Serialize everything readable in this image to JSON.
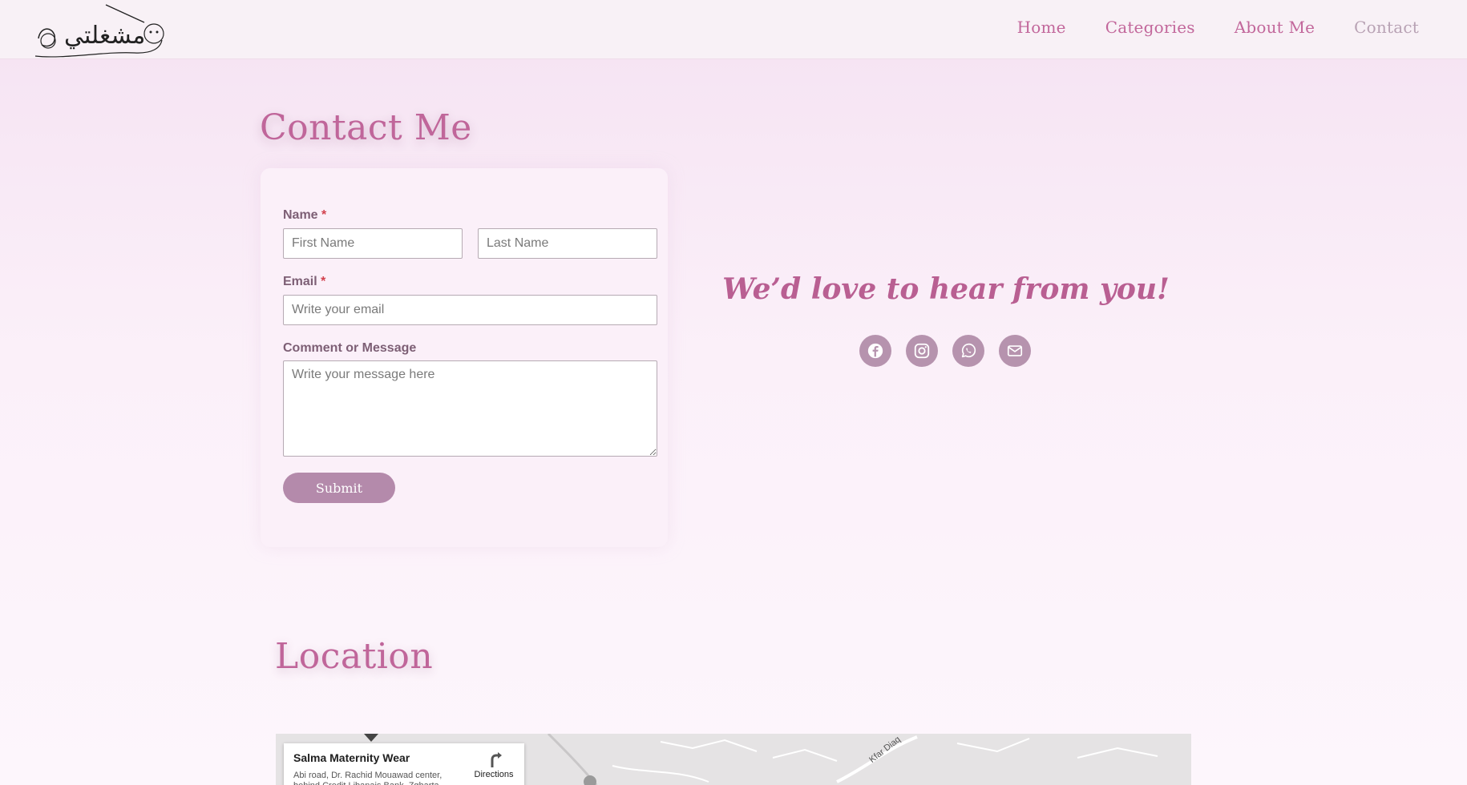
{
  "header": {
    "logo_text": "مشغلتي",
    "nav": [
      {
        "label": "Home",
        "current": false
      },
      {
        "label": "Categories",
        "current": false
      },
      {
        "label": "About Me",
        "current": false
      },
      {
        "label": "Contact",
        "current": true
      }
    ]
  },
  "contact": {
    "title": "Contact Me",
    "form": {
      "name_label": "Name",
      "email_label": "Email",
      "message_label": "Comment or Message",
      "required_mark": "*",
      "first_name_placeholder": "First Name",
      "last_name_placeholder": "Last Name",
      "email_placeholder": "Write your email",
      "message_placeholder": "Write your message here",
      "submit_label": "Submit"
    },
    "tagline": "We’d love to hear from you!",
    "socials": [
      "facebook-icon",
      "instagram-icon",
      "whatsapp-icon",
      "envelope-icon"
    ]
  },
  "location": {
    "title": "Location",
    "map": {
      "place_name": "Salma Maternity Wear",
      "address": "Abi road, Dr. Rachid Mouawad center, behind Credit Libanais Bank, Zgharta",
      "directions_label": "Directions",
      "road_label": "Kfar Diaq"
    }
  },
  "colors": {
    "accent": "#c0669a",
    "button": "#b48aab",
    "social_bg": "#b693ae",
    "required": "#d2424e"
  }
}
